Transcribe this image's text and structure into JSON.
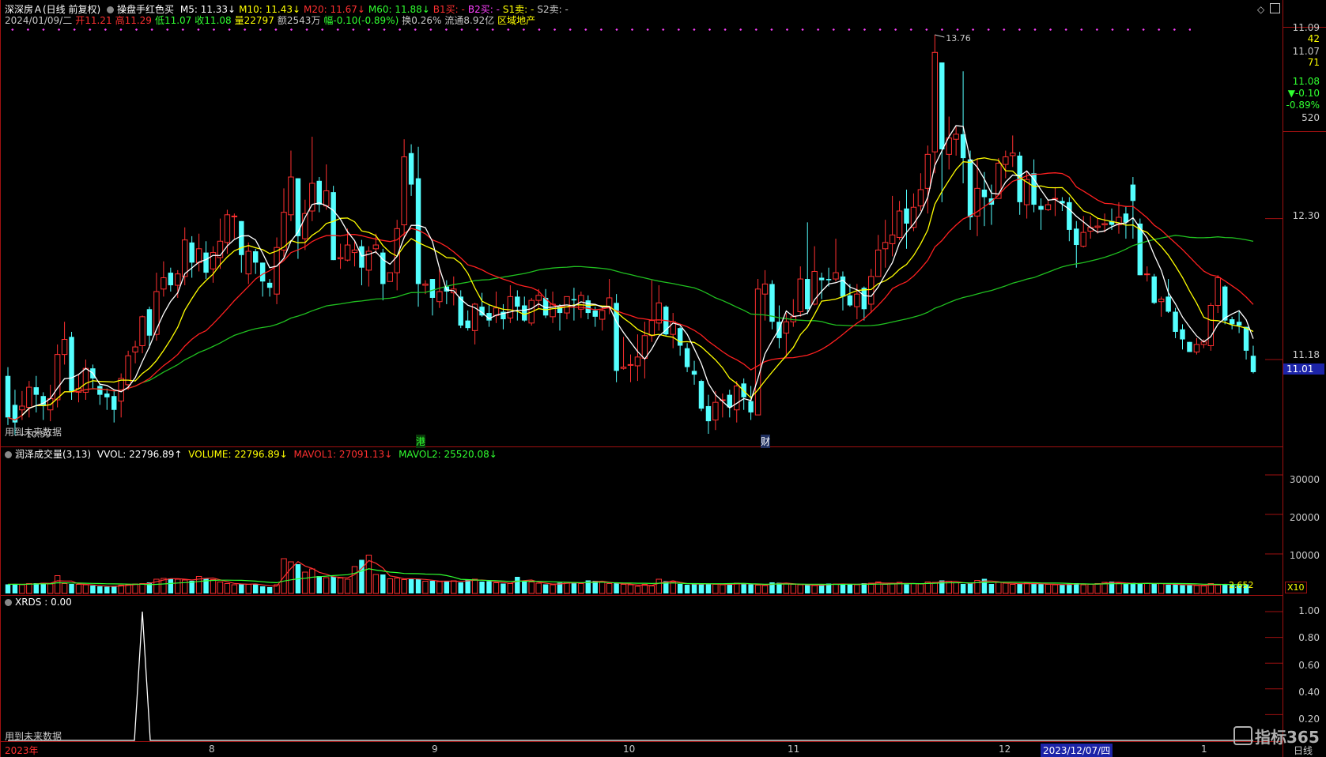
{
  "header": {
    "stock": "深深房Ａ(日线 前复权)",
    "indicator": "操盘手红色买",
    "ma_items": [
      {
        "label": "M5: 11.33↓",
        "color": "#ffffff"
      },
      {
        "label": "M10: 11.43↓",
        "color": "#ffff00"
      },
      {
        "label": "M20: 11.67↓",
        "color": "#ff3030"
      },
      {
        "label": "M60: 11.88↓",
        "color": "#30ff30"
      },
      {
        "label": "B1买: -",
        "color": "#ff3030"
      },
      {
        "label": "B2买: -",
        "color": "#ff40ff"
      },
      {
        "label": "S1卖: -",
        "color": "#ffff00"
      },
      {
        "label": "S2卖: -",
        "color": "#c8c8c8"
      }
    ],
    "info_items": [
      {
        "label": "2024/01/09/二",
        "color": "#c8c8c8"
      },
      {
        "label": "开11.21",
        "color": "#ff3030"
      },
      {
        "label": "高11.29",
        "color": "#ff3030"
      },
      {
        "label": "低11.07",
        "color": "#30ff30"
      },
      {
        "label": "收11.08",
        "color": "#30ff30"
      },
      {
        "label": "量22797",
        "color": "#ffff00"
      },
      {
        "label": "额2543万",
        "color": "#c8c8c8"
      },
      {
        "label": "幅-0.10(-0.89%)",
        "color": "#30ff30"
      },
      {
        "label": "换0.26%",
        "color": "#c8c8c8"
      },
      {
        "label": "流通8.92亿",
        "color": "#c8c8c8"
      },
      {
        "label": "区域地产",
        "color": "#ffff00"
      }
    ],
    "future_note": "用到未来数据",
    "marker_gang": "港",
    "marker_cai": "财",
    "high_label": "13.76",
    "low_label": "10.59"
  },
  "right_axis": {
    "top_values": [
      {
        "label": "11.09",
        "color": "#c8c8c8"
      },
      {
        "label": "42",
        "color": "#ffff00"
      },
      {
        "label": "11.07",
        "color": "#c8c8c8"
      },
      {
        "label": "71",
        "color": "#ffff00"
      },
      {
        "label": "11.08",
        "color": "#30ff30"
      },
      {
        "label": "▼-0.10",
        "color": "#30ff30"
      },
      {
        "label": "-0.89%",
        "color": "#30ff30"
      },
      {
        "label": "520",
        "color": "#c8c8c8"
      }
    ],
    "price_ticks": [
      "12.30",
      "11.18"
    ],
    "current_price": "11.01",
    "volume_ticks": [
      "30000",
      "20000",
      "10000"
    ],
    "volume_unit": "X10",
    "xrds_ticks": [
      "1.00",
      "0.80",
      "0.60",
      "0.40",
      "0.20"
    ]
  },
  "volume_header": {
    "name": "润泽成交量(3,13)",
    "vvol": "VVOL: 22796.89↑",
    "volume": "VOLUME: 22796.89↓",
    "mavol1": "MAVOL1: 27091.13↓",
    "mavol2": "MAVOL2: 25520.08↓",
    "last_label": "2.652"
  },
  "xrds_header": {
    "label": "XRDS : 0.00",
    "future_note": "用到未来数据"
  },
  "x_axis": {
    "labels": [
      "2023年",
      "8",
      "9",
      "10",
      "11",
      "12",
      "1"
    ],
    "highlight": "2023/12/07/四",
    "period": "日线"
  },
  "watermark": "指标365",
  "colors": {
    "up": "#ff3030",
    "down": "#54ffff",
    "ma5": "#ffffff",
    "ma10": "#ffff00",
    "ma20": "#ff2020",
    "ma60": "#20c020"
  },
  "chart_data": {
    "type": "candlestick",
    "price_range": [
      10.59,
      13.76
    ],
    "candles": [
      [
        11.05,
        10.72,
        11.12,
        10.66
      ],
      [
        10.82,
        10.68,
        10.94,
        10.58
      ],
      [
        10.78,
        10.81,
        10.93,
        10.7
      ],
      [
        10.8,
        10.96,
        11.01,
        10.72
      ],
      [
        10.96,
        10.9,
        11.05,
        10.76
      ],
      [
        10.89,
        10.81,
        10.92,
        10.7
      ],
      [
        10.78,
        10.87,
        10.98,
        10.69
      ],
      [
        10.86,
        11.22,
        11.3,
        10.8
      ],
      [
        11.22,
        11.34,
        11.48,
        11.14
      ],
      [
        11.36,
        10.93,
        11.4,
        10.86
      ],
      [
        10.92,
        10.95,
        11.06,
        10.84
      ],
      [
        10.92,
        11.11,
        11.18,
        10.86
      ],
      [
        11.11,
        11.03,
        11.14,
        10.95
      ],
      [
        10.97,
        10.9,
        10.99,
        10.82
      ],
      [
        10.91,
        10.88,
        10.95,
        10.78
      ],
      [
        10.89,
        10.78,
        10.94,
        10.68
      ],
      [
        10.85,
        11.03,
        11.07,
        10.72
      ],
      [
        10.98,
        11.21,
        11.25,
        10.94
      ],
      [
        11.24,
        11.28,
        11.33,
        11.15
      ],
      [
        11.29,
        11.52,
        11.53,
        11.23
      ],
      [
        11.58,
        11.37,
        11.6,
        11.27
      ],
      [
        11.38,
        11.72,
        11.87,
        11.33
      ],
      [
        11.74,
        11.83,
        11.96,
        11.68
      ],
      [
        11.87,
        11.77,
        11.91,
        11.72
      ],
      [
        11.77,
        11.86,
        11.89,
        11.67
      ],
      [
        11.84,
        12.13,
        12.23,
        11.77
      ],
      [
        12.11,
        11.95,
        12.16,
        11.83
      ],
      [
        11.95,
        12.06,
        12.18,
        11.88
      ],
      [
        12.03,
        11.87,
        12.12,
        11.82
      ],
      [
        11.9,
        12.03,
        12.08,
        11.79
      ],
      [
        11.99,
        12.12,
        12.3,
        11.9
      ],
      [
        12.11,
        12.33,
        12.37,
        12.02
      ],
      [
        12.32,
        12.32,
        12.34,
        12.14
      ],
      [
        12.28,
        12.01,
        12.28,
        11.87
      ],
      [
        11.86,
        12.04,
        12.11,
        11.78
      ],
      [
        12.04,
        11.95,
        12.06,
        11.86
      ],
      [
        11.95,
        11.8,
        11.95,
        11.68
      ],
      [
        11.79,
        11.75,
        11.82,
        11.68
      ],
      [
        11.7,
        12.07,
        12.15,
        11.62
      ],
      [
        12.05,
        12.35,
        12.54,
        11.99
      ],
      [
        12.33,
        12.63,
        12.84,
        12.28
      ],
      [
        12.62,
        12.16,
        12.62,
        11.98
      ],
      [
        12.14,
        12.34,
        12.45,
        12.05
      ],
      [
        12.36,
        12.58,
        12.95,
        12.28
      ],
      [
        12.6,
        12.41,
        12.63,
        12.35
      ],
      [
        12.4,
        12.52,
        12.73,
        12.37
      ],
      [
        12.51,
        11.97,
        12.56,
        11.97
      ],
      [
        11.98,
        11.99,
        12.1,
        11.9
      ],
      [
        11.97,
        12.09,
        12.22,
        11.96
      ],
      [
        12.03,
        12.05,
        12.12,
        11.92
      ],
      [
        12.08,
        11.91,
        12.13,
        11.77
      ],
      [
        11.89,
        12.04,
        12.08,
        11.76
      ],
      [
        12.06,
        12.09,
        12.18,
        12.02
      ],
      [
        12.03,
        11.78,
        12.06,
        11.65
      ],
      [
        11.8,
        11.87,
        11.87,
        11.83
      ],
      [
        11.87,
        12.22,
        12.29,
        11.73
      ],
      [
        12.25,
        12.79,
        12.93,
        12.14
      ],
      [
        12.82,
        12.57,
        12.89,
        12.48
      ],
      [
        12.62,
        11.78,
        12.87,
        11.6
      ],
      [
        11.77,
        11.78,
        11.81,
        11.7
      ],
      [
        11.82,
        11.67,
        11.82,
        11.53
      ],
      [
        11.64,
        11.72,
        11.9,
        11.59
      ],
      [
        11.76,
        11.72,
        11.81,
        11.62
      ],
      [
        11.71,
        11.74,
        11.84,
        11.61
      ],
      [
        11.68,
        11.45,
        11.73,
        11.43
      ],
      [
        11.49,
        11.43,
        11.57,
        11.41
      ],
      [
        11.41,
        11.62,
        11.63,
        11.3
      ],
      [
        11.6,
        11.53,
        11.71,
        11.52
      ],
      [
        11.55,
        11.49,
        11.62,
        11.44
      ],
      [
        11.53,
        11.59,
        11.72,
        11.47
      ],
      [
        11.56,
        11.5,
        11.62,
        11.42
      ],
      [
        11.51,
        11.68,
        11.77,
        11.47
      ],
      [
        11.68,
        11.6,
        11.73,
        11.49
      ],
      [
        11.61,
        11.49,
        11.68,
        11.48
      ],
      [
        11.47,
        11.65,
        11.67,
        11.45
      ],
      [
        11.65,
        11.69,
        11.74,
        11.59
      ],
      [
        11.67,
        11.53,
        11.74,
        11.51
      ],
      [
        11.52,
        11.62,
        11.72,
        11.47
      ],
      [
        11.6,
        11.55,
        11.62,
        11.41
      ],
      [
        11.55,
        11.68,
        11.68,
        11.5
      ],
      [
        11.66,
        11.65,
        11.75,
        11.49
      ],
      [
        11.58,
        11.69,
        11.72,
        11.51
      ],
      [
        11.65,
        11.55,
        11.69,
        11.5
      ],
      [
        11.57,
        11.52,
        11.6,
        11.44
      ],
      [
        11.5,
        11.57,
        11.6,
        11.41
      ],
      [
        11.59,
        11.67,
        11.82,
        11.54
      ],
      [
        11.63,
        11.09,
        11.7,
        11.0
      ],
      [
        11.11,
        11.12,
        11.36,
        11.1
      ],
      [
        11.14,
        11.14,
        11.22,
        11.0
      ],
      [
        11.13,
        11.2,
        11.38,
        11.01
      ],
      [
        11.19,
        11.37,
        11.48,
        11.03
      ],
      [
        11.37,
        11.49,
        11.81,
        11.32
      ],
      [
        11.47,
        11.63,
        11.77,
        11.41
      ],
      [
        11.6,
        11.38,
        11.61,
        11.37
      ],
      [
        11.38,
        11.48,
        11.55,
        11.27
      ],
      [
        11.43,
        11.29,
        11.44,
        11.21
      ],
      [
        11.27,
        11.12,
        11.31,
        11.08
      ],
      [
        11.09,
        11.06,
        11.17,
        10.98
      ],
      [
        11.01,
        10.79,
        11.02,
        10.77
      ],
      [
        10.81,
        10.69,
        10.9,
        10.59
      ],
      [
        10.7,
        10.84,
        10.93,
        10.62
      ],
      [
        10.86,
        10.86,
        10.91,
        10.72
      ],
      [
        10.9,
        10.8,
        10.94,
        10.72
      ],
      [
        10.78,
        10.97,
        11.01,
        10.68
      ],
      [
        10.99,
        10.88,
        11.03,
        10.78
      ],
      [
        10.85,
        10.76,
        10.97,
        10.7
      ],
      [
        10.74,
        11.74,
        11.82,
        10.74
      ],
      [
        11.7,
        11.78,
        11.89,
        11.49
      ],
      [
        11.78,
        11.48,
        11.81,
        11.42
      ],
      [
        11.48,
        11.35,
        11.61,
        11.27
      ],
      [
        11.39,
        11.48,
        11.55,
        11.2
      ],
      [
        11.48,
        11.52,
        11.66,
        11.44
      ],
      [
        11.56,
        11.82,
        11.92,
        11.52
      ],
      [
        11.82,
        11.58,
        12.27,
        11.54
      ],
      [
        11.62,
        11.88,
        12.08,
        11.61
      ],
      [
        11.83,
        11.81,
        11.87,
        11.66
      ],
      [
        11.82,
        11.81,
        11.91,
        11.76
      ],
      [
        11.82,
        11.87,
        12.14,
        11.8
      ],
      [
        11.84,
        11.68,
        11.88,
        11.57
      ],
      [
        11.69,
        11.61,
        11.78,
        11.6
      ],
      [
        11.6,
        11.7,
        11.78,
        11.5
      ],
      [
        11.75,
        11.58,
        11.76,
        11.49
      ],
      [
        11.62,
        11.84,
        11.9,
        11.55
      ],
      [
        11.84,
        12.05,
        12.17,
        11.84
      ],
      [
        12.06,
        12.11,
        12.29,
        11.91
      ],
      [
        12.1,
        12.17,
        12.48,
        12.0
      ],
      [
        12.15,
        12.36,
        12.44,
        12.13
      ],
      [
        12.38,
        12.26,
        12.53,
        12.06
      ],
      [
        12.23,
        12.39,
        12.5,
        12.2
      ],
      [
        12.4,
        12.53,
        12.66,
        12.36
      ],
      [
        12.54,
        12.81,
        12.88,
        12.34
      ],
      [
        12.83,
        13.62,
        13.76,
        12.66
      ],
      [
        13.54,
        12.85,
        13.25,
        12.43
      ],
      [
        12.81,
        12.94,
        13.11,
        12.69
      ],
      [
        12.93,
        12.97,
        13.03,
        12.8
      ],
      [
        12.97,
        12.78,
        13.47,
        12.58
      ],
      [
        12.77,
        12.31,
        12.84,
        12.21
      ],
      [
        12.32,
        12.54,
        12.78,
        12.16
      ],
      [
        12.53,
        12.47,
        12.67,
        12.24
      ],
      [
        12.46,
        12.41,
        12.57,
        12.25
      ],
      [
        12.46,
        12.74,
        12.78,
        12.46
      ],
      [
        12.73,
        12.79,
        12.84,
        12.62
      ],
      [
        12.8,
        12.82,
        12.96,
        12.71
      ],
      [
        12.8,
        12.43,
        12.83,
        12.33
      ],
      [
        12.41,
        12.61,
        12.68,
        12.3
      ],
      [
        12.66,
        12.41,
        12.77,
        12.35
      ],
      [
        12.4,
        12.37,
        12.46,
        12.21
      ],
      [
        12.37,
        12.41,
        12.45,
        12.36
      ],
      [
        12.46,
        12.46,
        12.55,
        12.32
      ],
      [
        12.44,
        12.42,
        12.47,
        12.36
      ],
      [
        12.43,
        12.21,
        12.47,
        12.12
      ],
      [
        12.22,
        12.09,
        12.28,
        11.91
      ],
      [
        12.08,
        12.19,
        12.32,
        12.07
      ],
      [
        12.2,
        12.23,
        12.32,
        12.14
      ],
      [
        12.23,
        12.24,
        12.3,
        12.18
      ],
      [
        12.25,
        12.26,
        12.34,
        12.19
      ],
      [
        12.28,
        12.25,
        12.38,
        12.21
      ],
      [
        12.25,
        12.31,
        12.43,
        12.18
      ],
      [
        12.34,
        12.27,
        12.4,
        12.14
      ],
      [
        12.57,
        12.44,
        12.63,
        12.14
      ],
      [
        12.26,
        11.85,
        12.3,
        11.85
      ],
      [
        11.86,
        11.86,
        11.92,
        11.8
      ],
      [
        11.84,
        11.63,
        11.86,
        11.62
      ],
      [
        11.64,
        11.66,
        11.68,
        11.52
      ],
      [
        11.68,
        11.56,
        11.82,
        11.55
      ],
      [
        11.56,
        11.4,
        11.59,
        11.35
      ],
      [
        11.42,
        11.34,
        11.46,
        11.26
      ],
      [
        11.32,
        11.24,
        11.32,
        11.24
      ],
      [
        11.24,
        11.3,
        11.35,
        11.22
      ],
      [
        11.3,
        11.32,
        11.34,
        11.27
      ],
      [
        11.29,
        11.61,
        11.63,
        11.25
      ],
      [
        11.61,
        11.83,
        11.85,
        11.55
      ],
      [
        11.76,
        11.49,
        11.77,
        11.46
      ],
      [
        11.5,
        11.46,
        11.52,
        11.42
      ],
      [
        11.48,
        11.45,
        11.56,
        11.39
      ],
      [
        11.44,
        11.25,
        11.44,
        11.18
      ],
      [
        11.21,
        11.08,
        11.29,
        11.07
      ]
    ],
    "volumes": [
      2300,
      2400,
      2200,
      2500,
      2600,
      2700,
      2400,
      4500,
      2500,
      2400,
      2300,
      2200,
      2000,
      1800,
      1700,
      1900,
      2100,
      2200,
      2400,
      2500,
      2800,
      3600,
      3800,
      3800,
      3600,
      3400,
      3200,
      4300,
      3900,
      3500,
      2900,
      2500,
      2200,
      2500,
      2300,
      2400,
      1800,
      1600,
      2200,
      8800,
      8000,
      7400,
      5400,
      6200,
      4400,
      4000,
      4300,
      3900,
      3600,
      6800,
      8500,
      9700,
      4800,
      4800,
      3700,
      3900,
      3500,
      3800,
      3700,
      3100,
      3200,
      3000,
      3100,
      3200,
      2800,
      3600,
      3600,
      3000,
      3100,
      2700,
      2500,
      2500,
      4200,
      3100,
      2900,
      2600,
      2300,
      2200,
      2700,
      2800,
      2600,
      2500,
      3300,
      3200,
      2800,
      2500,
      2600,
      2300,
      2200,
      1800,
      2300,
      1900,
      3600,
      3100,
      2900,
      2400,
      2200,
      2600,
      2300,
      2400,
      2300,
      2200,
      2400,
      2600,
      2400,
      2300,
      2100,
      2000,
      2800,
      2700,
      2400,
      2300,
      2200,
      2100,
      2000,
      2200,
      2500,
      2400,
      2300,
      2400,
      2200,
      2600,
      2600,
      2900,
      2300,
      2600,
      2800,
      2300,
      2500,
      2400,
      2900,
      2800,
      3300,
      3100,
      2700,
      2400,
      2500,
      3300,
      3700,
      2400,
      2800,
      2600,
      2300,
      2500,
      2600,
      2400,
      2400,
      2300,
      2200,
      2200,
      2400,
      2600,
      2200,
      2300,
      2500,
      2800,
      3000,
      2600,
      2400,
      2700,
      2500,
      2600,
      2400,
      2500,
      2200,
      2300,
      2100,
      2200,
      2000,
      1900,
      2500,
      2100,
      2400,
      2200,
      2000,
      2300
    ],
    "ma5": [],
    "vol_max": 35000,
    "xrds_spike_index": 19,
    "xrds_value": 0.0
  }
}
